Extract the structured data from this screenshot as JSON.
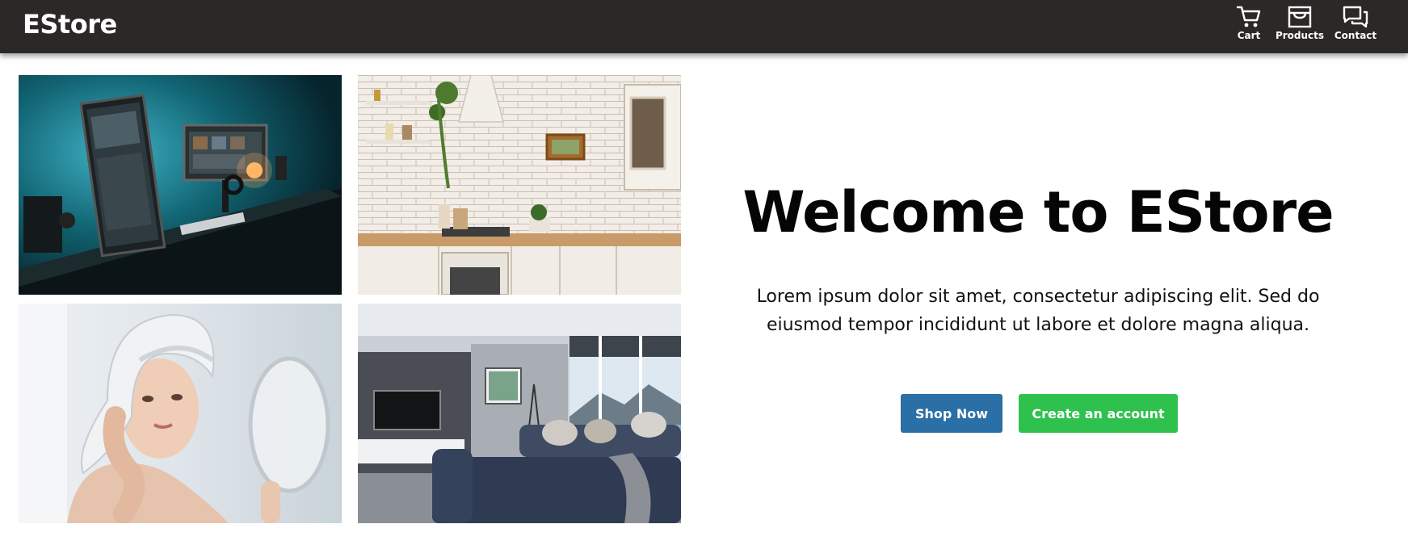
{
  "navbar": {
    "brand": "EStore",
    "items": [
      {
        "label": "Cart",
        "icon": "cart-icon"
      },
      {
        "label": "Products",
        "icon": "store-icon"
      },
      {
        "label": "Contact",
        "icon": "chat-icon"
      }
    ]
  },
  "gallery": {
    "images": [
      {
        "name": "desk-setup-image",
        "subject": "computer desk with monitors"
      },
      {
        "name": "kitchen-image",
        "subject": "white brick kitchen"
      },
      {
        "name": "woman-mirror-image",
        "subject": "woman with towel looking in mirror"
      },
      {
        "name": "living-room-image",
        "subject": "living room with sofa and tv"
      }
    ]
  },
  "hero": {
    "title": "Welcome to EStore",
    "text": "Lorem ipsum dolor sit amet, consectetur adipiscing elit. Sed do eiusmod tempor incididunt ut labore et dolore magna aliqua."
  },
  "buttons": {
    "shop_label": "Shop Now",
    "create_label": "Create an account"
  },
  "colors": {
    "navbar_bg": "#2b2827",
    "shop_button": "#2a6fa5",
    "create_button": "#2fc14e"
  }
}
